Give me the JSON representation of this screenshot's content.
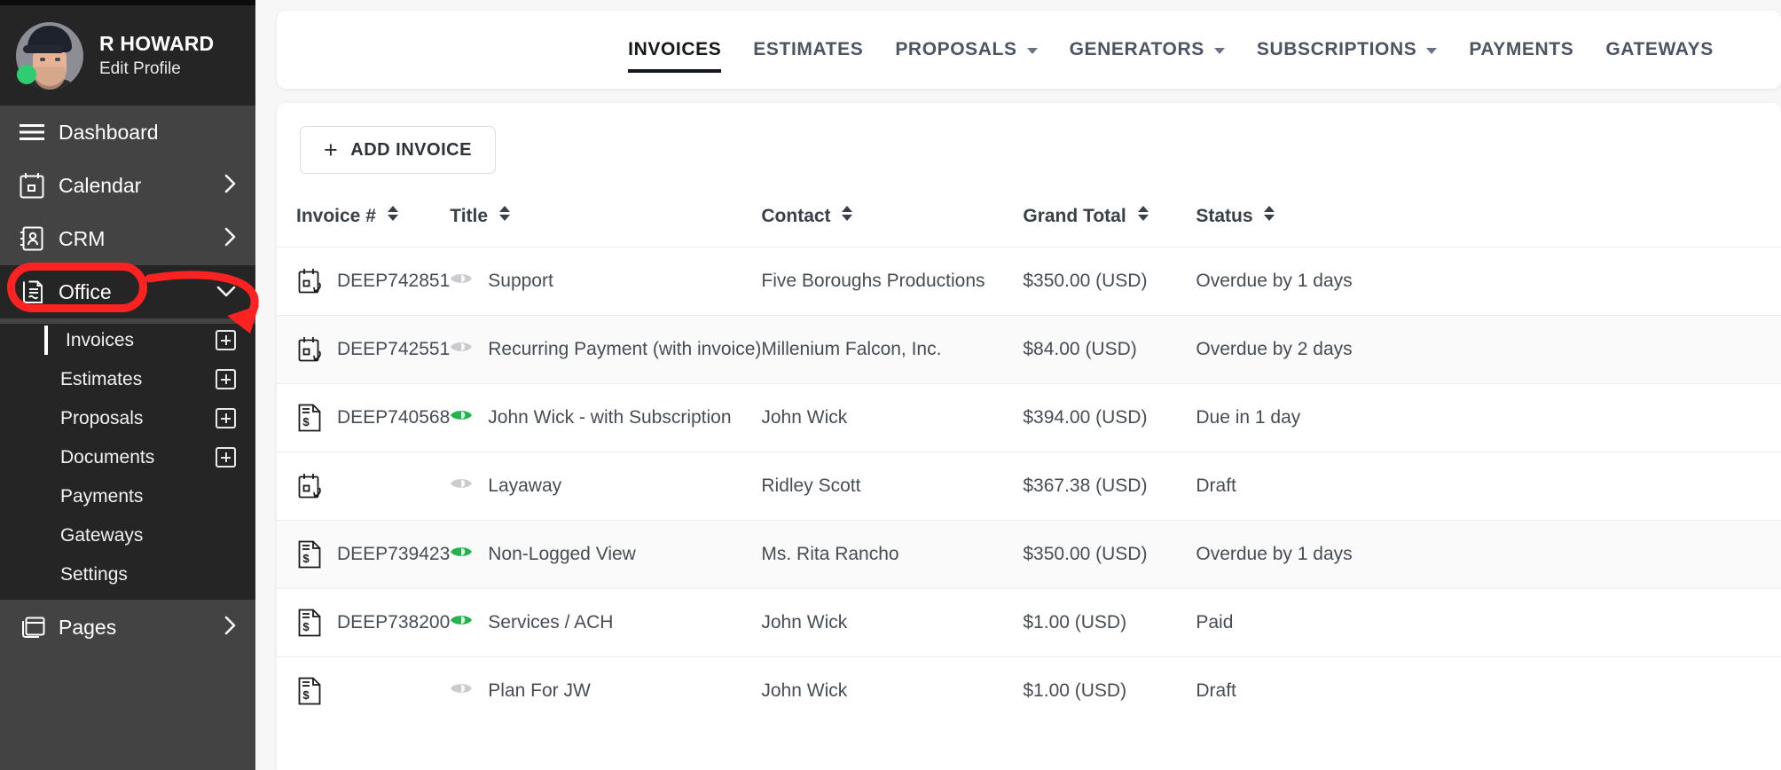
{
  "profile": {
    "name": "R HOWARD",
    "edit_label": "Edit Profile",
    "status_color": "#2fcc71",
    "avatar_icon": "user-avatar"
  },
  "sidebar": {
    "items": [
      {
        "label": "Dashboard",
        "icon": "hamburger-icon",
        "has_chevron": false,
        "state": "grey"
      },
      {
        "label": "Calendar",
        "icon": "calendar-icon",
        "has_chevron": true,
        "chevron": "chevron-right-icon",
        "state": "grey"
      },
      {
        "label": "CRM",
        "icon": "contact-book-icon",
        "has_chevron": true,
        "chevron": "chevron-right-icon",
        "state": "grey"
      },
      {
        "label": "Office",
        "icon": "document-pen-icon",
        "has_chevron": true,
        "chevron": "chevron-down-icon",
        "state": "dark",
        "highlighted": true
      }
    ],
    "submenu": [
      {
        "label": "Invoices",
        "active": true,
        "add_icon": "plus-box-icon",
        "has_add": true
      },
      {
        "label": "Estimates",
        "active": false,
        "add_icon": "plus-box-icon",
        "has_add": true
      },
      {
        "label": "Proposals",
        "active": false,
        "add_icon": "plus-box-icon",
        "has_add": true
      },
      {
        "label": "Documents",
        "active": false,
        "add_icon": "plus-box-icon",
        "has_add": true
      },
      {
        "label": "Payments",
        "active": false,
        "has_add": false
      },
      {
        "label": "Gateways",
        "active": false,
        "has_add": false
      },
      {
        "label": "Settings",
        "active": false,
        "has_add": false
      }
    ],
    "footer_items": [
      {
        "label": "Pages",
        "icon": "pages-icon",
        "has_chevron": true,
        "chevron": "chevron-right-icon",
        "state": "grey"
      }
    ],
    "annotation": {
      "shape": "oval",
      "color": "#fc2222",
      "target": "Office",
      "arrow_points_to": "Invoices"
    }
  },
  "tabs": [
    {
      "label": "INVOICES",
      "active": true,
      "dropdown": false
    },
    {
      "label": "ESTIMATES",
      "active": false,
      "dropdown": false
    },
    {
      "label": "PROPOSALS",
      "active": false,
      "dropdown": true,
      "dropdown_icon": "chevron-down-icon"
    },
    {
      "label": "GENERATORS",
      "active": false,
      "dropdown": true,
      "dropdown_icon": "chevron-down-icon"
    },
    {
      "label": "SUBSCRIPTIONS",
      "active": false,
      "dropdown": true,
      "dropdown_icon": "chevron-down-icon"
    },
    {
      "label": "PAYMENTS",
      "active": false,
      "dropdown": false
    },
    {
      "label": "GATEWAYS",
      "active": false,
      "dropdown": false
    }
  ],
  "toolbar": {
    "add_invoice_label": "ADD INVOICE",
    "add_icon": "plus-icon"
  },
  "table": {
    "columns": [
      {
        "label": "Invoice #",
        "sortable": true,
        "sort_icon": "sort-arrows-icon"
      },
      {
        "label": "Title",
        "sortable": true,
        "sort_icon": "sort-arrows-icon"
      },
      {
        "label": "Contact",
        "sortable": true,
        "sort_icon": "sort-arrows-icon"
      },
      {
        "label": "Grand Total",
        "sortable": true,
        "sort_icon": "sort-arrows-icon"
      },
      {
        "label": "Status",
        "sortable": true,
        "sort_icon": "sort-arrows-icon"
      }
    ],
    "rows": [
      {
        "type_icon": "recurring-invoice-icon",
        "invoice": "DEEP742851",
        "visibility_icon": "eye-icon",
        "visibility": "hidden",
        "title": "Support",
        "contact": "Five Boroughs Productions",
        "total": "$350.00 (USD)",
        "status": "Overdue by 1 days",
        "alt": false
      },
      {
        "type_icon": "recurring-invoice-icon",
        "invoice": "DEEP742551",
        "visibility_icon": "eye-icon",
        "visibility": "hidden",
        "title": "Recurring Payment (with invoice)",
        "contact": "Millenium Falcon, Inc.",
        "total": "$84.00 (USD)",
        "status": "Overdue by 2 days",
        "alt": true
      },
      {
        "type_icon": "invoice-doc-icon",
        "invoice": "DEEP740568",
        "visibility_icon": "eye-icon",
        "visibility": "visible",
        "title": "John Wick - with Subscription",
        "contact": "John Wick",
        "total": "$394.00 (USD)",
        "status": "Due in 1 day",
        "alt": false
      },
      {
        "type_icon": "recurring-invoice-icon",
        "invoice": "",
        "visibility_icon": "eye-icon",
        "visibility": "hidden",
        "title": "Layaway",
        "contact": "Ridley Scott",
        "total": "$367.38 (USD)",
        "status": "Draft",
        "alt": false
      },
      {
        "type_icon": "invoice-doc-icon",
        "invoice": "DEEP739423",
        "visibility_icon": "eye-icon",
        "visibility": "visible",
        "title": "Non-Logged View",
        "contact": "Ms. Rita Rancho",
        "total": "$350.00 (USD)",
        "status": "Overdue by 1 days",
        "alt": true
      },
      {
        "type_icon": "invoice-doc-icon",
        "invoice": "DEEP738200",
        "visibility_icon": "eye-icon",
        "visibility": "visible",
        "title": "Services / ACH",
        "contact": "John Wick",
        "total": "$1.00 (USD)",
        "status": "Paid",
        "alt": false
      },
      {
        "type_icon": "invoice-doc-icon",
        "invoice": "",
        "visibility_icon": "eye-icon",
        "visibility": "hidden",
        "title": "Plan For JW",
        "contact": "John Wick",
        "total": "$1.00 (USD)",
        "status": "Draft",
        "alt": false
      }
    ]
  },
  "colors": {
    "sidebar_bg": "#434343",
    "sidebar_dark": "#252525",
    "accent_green": "#21b24b",
    "annotation_red": "#fc2222",
    "page_bg": "#f7f7f8"
  }
}
